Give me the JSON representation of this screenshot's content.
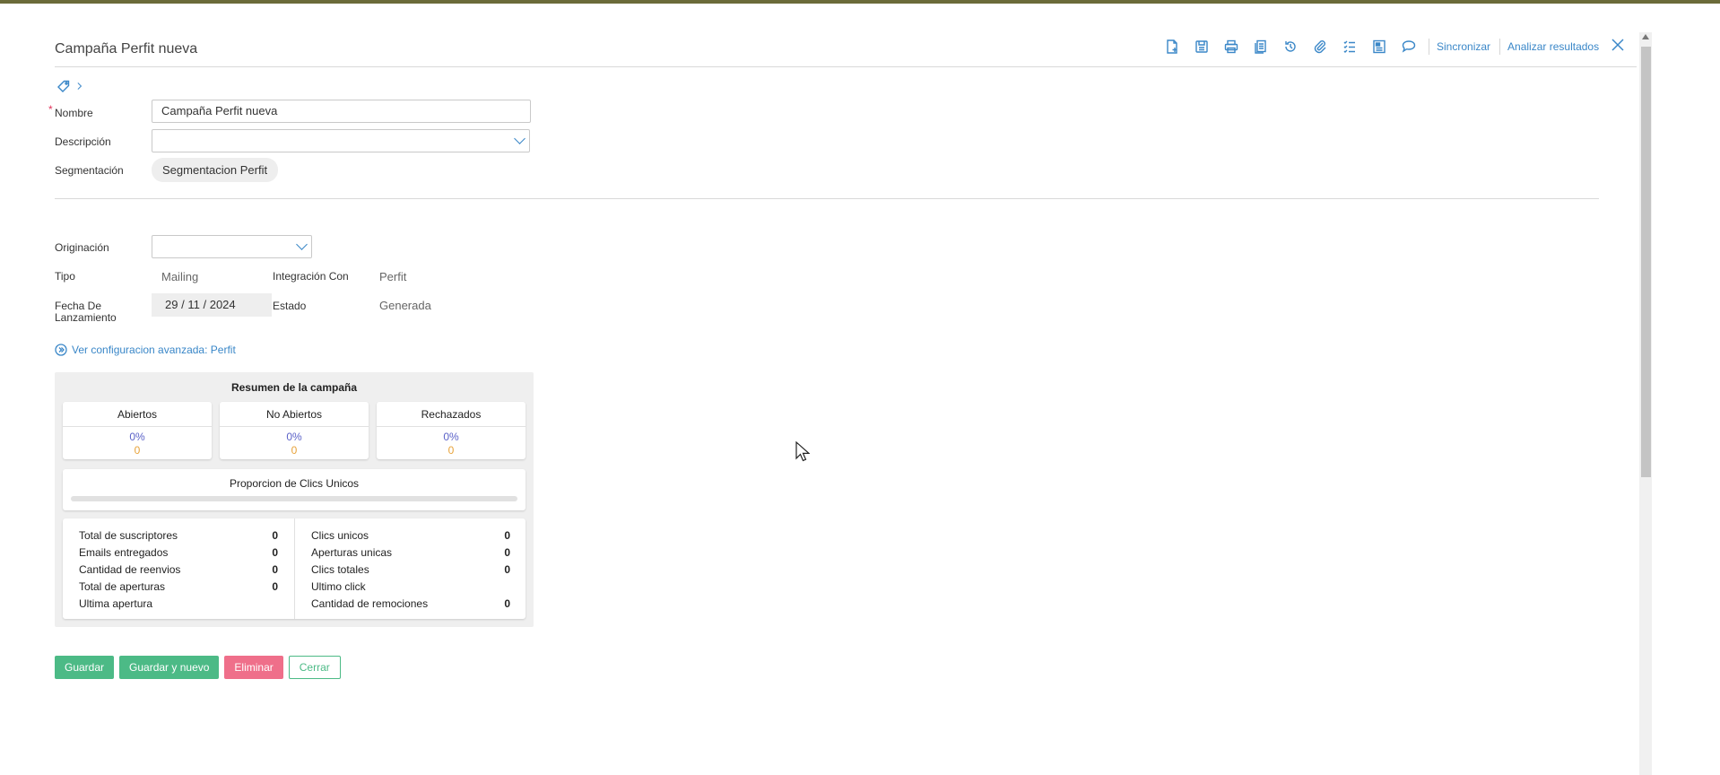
{
  "header": {
    "title": "Campaña Perfit nueva"
  },
  "toolbar": {
    "icons": [
      "new-document-icon",
      "save-icon",
      "print-icon",
      "copy-icon",
      "history-icon",
      "attachment-icon",
      "checklist-icon",
      "report-icon",
      "comment-icon",
      "close-icon"
    ],
    "sync_label": "Sincronizar",
    "analyze_label": "Analizar resultados"
  },
  "form": {
    "nombre": {
      "label": "Nombre",
      "required_mark": "*",
      "value": "Campaña Perfit nueva"
    },
    "descripcion": {
      "label": "Descripción",
      "value": ""
    },
    "segmentacion": {
      "label": "Segmentación",
      "value": "Segmentacion Perfit"
    },
    "originacion": {
      "label": "Originación",
      "value": ""
    },
    "tipo": {
      "label": "Tipo",
      "value": "Mailing"
    },
    "integracion": {
      "label": "Integración Con",
      "value": "Perfit"
    },
    "fecha": {
      "label_line1": "Fecha De",
      "label_line2": "Lanzamiento",
      "day": "29",
      "month": "11",
      "year": "2024",
      "sep": "/"
    },
    "estado": {
      "label": "Estado",
      "value": "Generada"
    }
  },
  "advanced_link": "Ver configuracion avanzada: Perfit",
  "summary": {
    "title": "Resumen de la campaña",
    "cards": [
      {
        "title": "Abiertos",
        "percent": "0%",
        "count": "0"
      },
      {
        "title": "No Abiertos",
        "percent": "0%",
        "count": "0"
      },
      {
        "title": "Rechazados",
        "percent": "0%",
        "count": "0"
      }
    ],
    "proportion": {
      "title": "Proporcion de Clics Unicos",
      "fill_fraction": 0
    },
    "stats_left": [
      {
        "label": "Total de suscriptores",
        "value": "0"
      },
      {
        "label": "Emails entregados",
        "value": "0"
      },
      {
        "label": "Cantidad de reenvios",
        "value": "0"
      },
      {
        "label": "Total de aperturas",
        "value": "0"
      },
      {
        "label": "Ultima apertura",
        "value": ""
      }
    ],
    "stats_right": [
      {
        "label": "Clics unicos",
        "value": "0"
      },
      {
        "label": "Aperturas unicas",
        "value": "0"
      },
      {
        "label": "Clics totales",
        "value": "0"
      },
      {
        "label": "Ultimo click",
        "value": ""
      },
      {
        "label": "Cantidad de remociones",
        "value": "0"
      }
    ]
  },
  "buttons": {
    "save": "Guardar",
    "save_new": "Guardar y nuevo",
    "delete": "Eliminar",
    "close": "Cerrar"
  },
  "colors": {
    "accent": "#3a87c8",
    "green": "#4cba86",
    "danger": "#ef6f8a",
    "percent": "#5b62c8",
    "count": "#e8a33a"
  }
}
